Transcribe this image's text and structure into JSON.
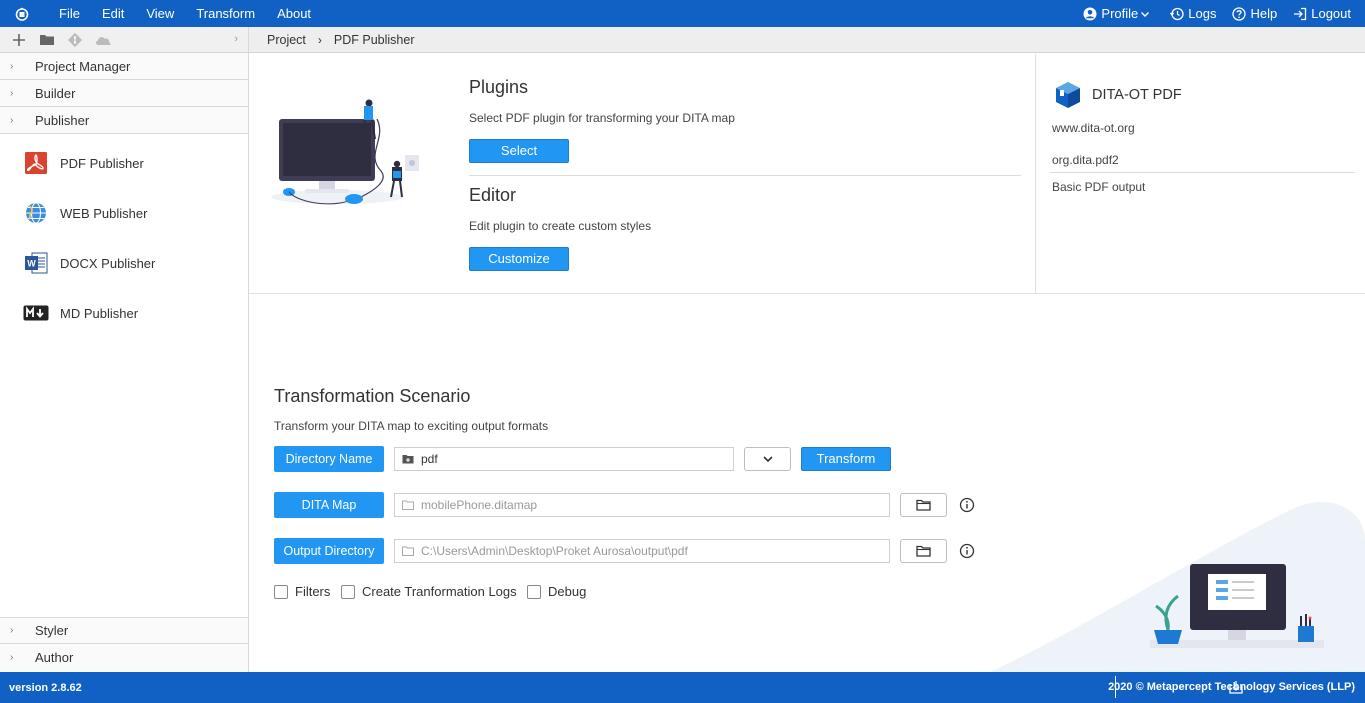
{
  "menu": {
    "items": [
      "File",
      "Edit",
      "View",
      "Transform",
      "About"
    ],
    "profile": "Profile",
    "logs": "Logs",
    "help": "Help",
    "logout": "Logout"
  },
  "sidebar": {
    "sections_top": [
      {
        "label": "Project Manager"
      },
      {
        "label": "Builder"
      },
      {
        "label": "Publisher"
      }
    ],
    "publishers": [
      {
        "label": "PDF Publisher",
        "icon": "pdf-icon"
      },
      {
        "label": "WEB Publisher",
        "icon": "web-globe-icon"
      },
      {
        "label": "DOCX Publisher",
        "icon": "word-docx-icon"
      },
      {
        "label": "MD Publisher",
        "icon": "markdown-icon"
      }
    ],
    "sections_bottom": [
      {
        "label": "Styler"
      },
      {
        "label": "Author"
      }
    ]
  },
  "breadcrumb": {
    "project": "Project",
    "current": "PDF Publisher"
  },
  "plugins": {
    "title": "Plugins",
    "description": "Select PDF plugin for transforming your DITA map",
    "select_label": "Select"
  },
  "editor": {
    "title": "Editor",
    "description": "Edit plugin to create custom styles",
    "customize_label": "Customize"
  },
  "plugin_info": {
    "name": "DITA-OT PDF",
    "url": "www.dita-ot.org",
    "id": "org.dita.pdf2",
    "description": "Basic PDF output"
  },
  "scenario": {
    "title": "Transformation Scenario",
    "description": "Transform your DITA map to exciting output formats",
    "directory_label": "Directory Name",
    "directory_value": "pdf",
    "transform_label": "Transform",
    "ditamap_label": "DITA Map",
    "ditamap_placeholder": "mobilePhone.ditamap",
    "output_label": "Output Directory",
    "output_placeholder": "C:\\Users\\Admin\\Desktop\\Proket Aurosa\\output\\pdf",
    "checkboxes": [
      {
        "label": "Filters",
        "checked": false
      },
      {
        "label": "Create Tranformation Logs",
        "checked": false
      },
      {
        "label": "Debug",
        "checked": false
      }
    ]
  },
  "footer": {
    "version": "version 2.8.62",
    "copyright": "2020 © Metapercept Technology Services (LLP)"
  },
  "colors": {
    "brand": "#1160c4",
    "button": "#2196f3"
  }
}
